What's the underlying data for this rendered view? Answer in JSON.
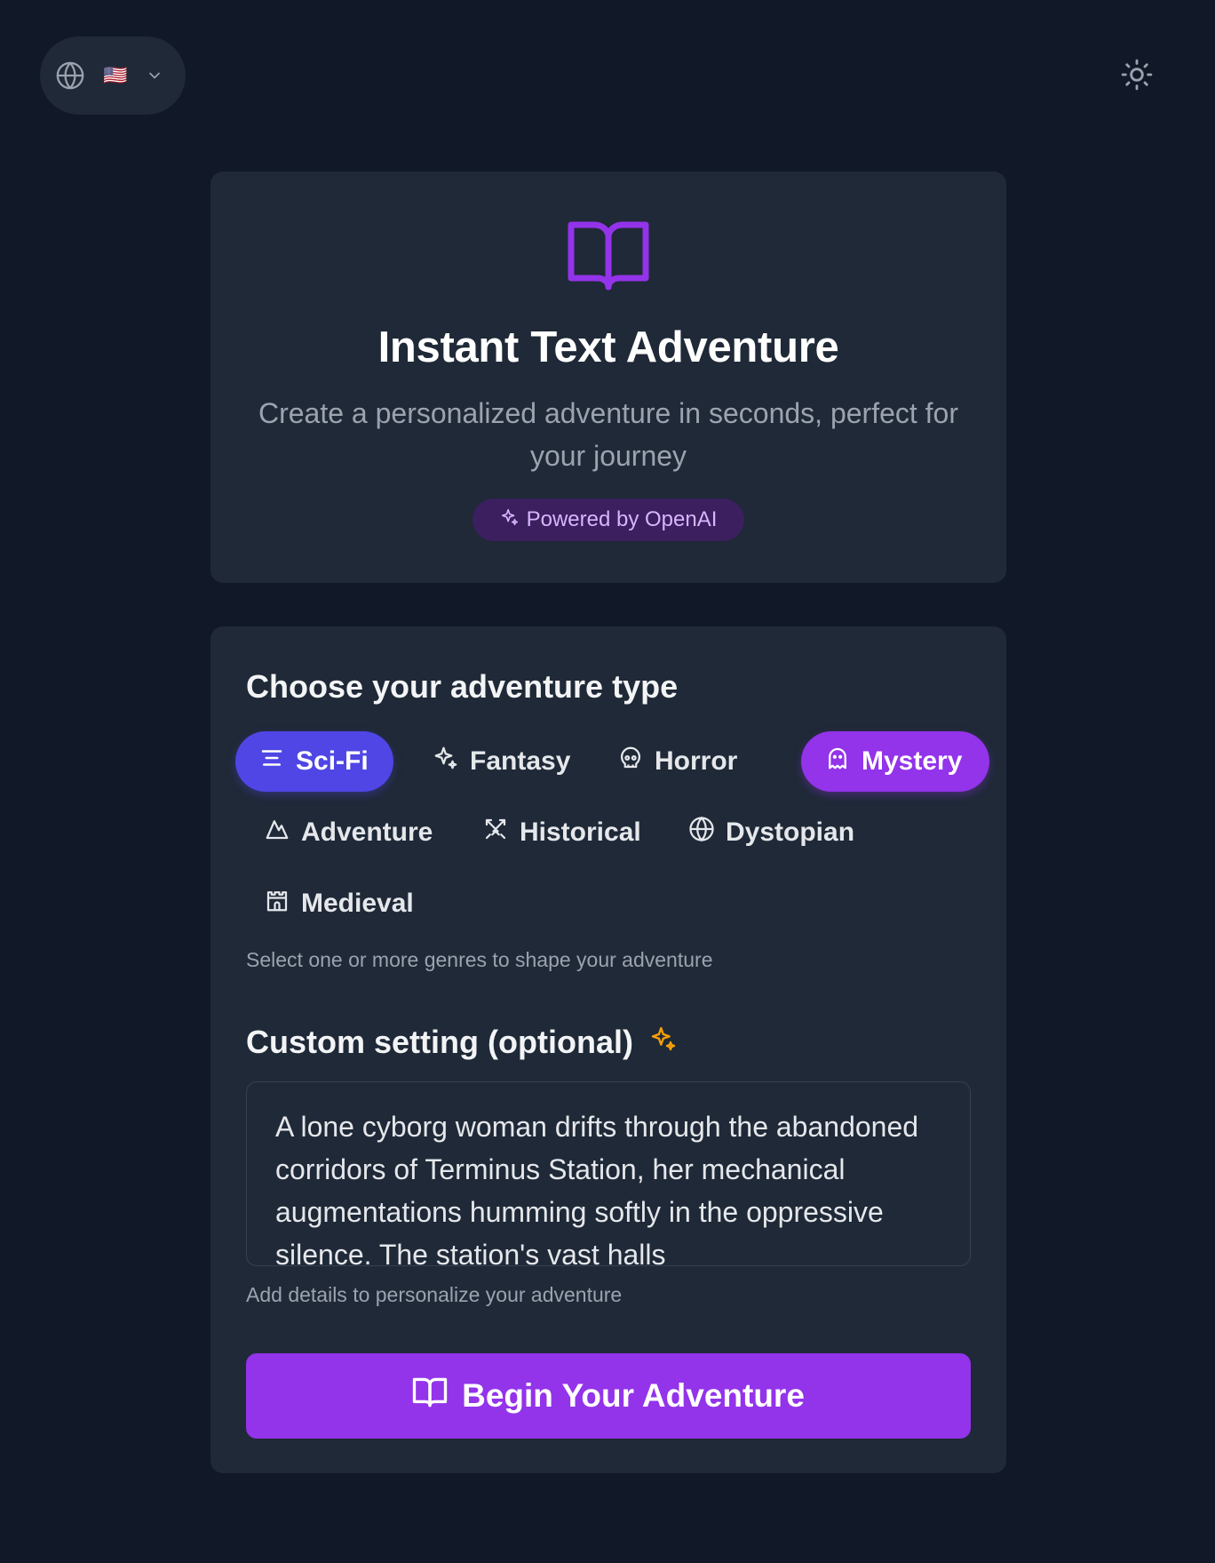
{
  "top_bar": {
    "language_flag": "🇺🇸",
    "icons": {
      "language": "globe-icon",
      "dropdown": "chevron-down-icon",
      "theme": "sun-icon"
    }
  },
  "hero": {
    "icon": "book-open-icon",
    "title": "Instant Text Adventure",
    "subtitle": "Create a personalized adventure in seconds, perfect for your journey",
    "badge": "Powered by OpenAI"
  },
  "form": {
    "adventure_type_heading": "Choose your adventure type",
    "genres": [
      {
        "label": "Sci-Fi",
        "icon": "lines-icon",
        "selected": true
      },
      {
        "label": "Fantasy",
        "icon": "sparkles-icon",
        "selected": false
      },
      {
        "label": "Horror",
        "icon": "skull-icon",
        "selected": false
      },
      {
        "label": "Mystery",
        "icon": "ghost-icon",
        "selected": true
      },
      {
        "label": "Adventure",
        "icon": "mountain-icon",
        "selected": false
      },
      {
        "label": "Historical",
        "icon": "swords-icon",
        "selected": false
      },
      {
        "label": "Dystopian",
        "icon": "globe-icon",
        "selected": false
      },
      {
        "label": "Medieval",
        "icon": "castle-icon",
        "selected": false
      }
    ],
    "genres_hint": "Select one or more genres to shape your adventure",
    "custom_heading": "Custom setting (optional)",
    "custom_value": "A lone cyborg woman drifts through the abandoned corridors of Terminus Station, her mechanical augmentations humming softly in the oppressive silence. The station's vast halls",
    "custom_hint": "Add details to personalize your adventure",
    "submit_label": "Begin Your Adventure"
  },
  "colors": {
    "background": "#111827",
    "card": "#1f2937",
    "accent_purple": "#9333ea",
    "accent_indigo": "#4f46e5",
    "sparkle_amber": "#f59e0b"
  }
}
